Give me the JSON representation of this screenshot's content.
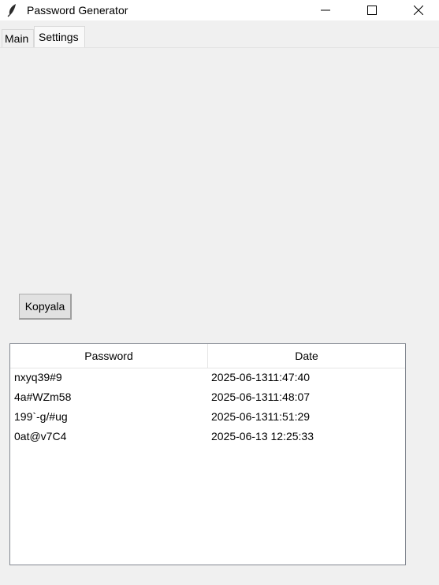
{
  "window": {
    "title": "Password Generator",
    "icon": "feather-icon",
    "controls": [
      "minimize-icon",
      "maximize-icon",
      "close-icon"
    ]
  },
  "tabs": [
    {
      "label": "Main",
      "selected": false
    },
    {
      "label": "Settings",
      "selected": true
    }
  ],
  "main": {
    "copy_button_label": "Kopyala"
  },
  "table": {
    "columns": [
      "Password",
      "Date"
    ],
    "rows": [
      {
        "password": "nxyq39#9",
        "date": "2025-06-1311:47:40"
      },
      {
        "password": "4a#WZm58",
        "date": "2025-06-1311:48:07"
      },
      {
        "password": "199`-g/#ug",
        "date": "2025-06-1311:51:29"
      },
      {
        "password": "0at@v7C4",
        "date": "2025-06-13 12:25:33"
      }
    ]
  }
}
